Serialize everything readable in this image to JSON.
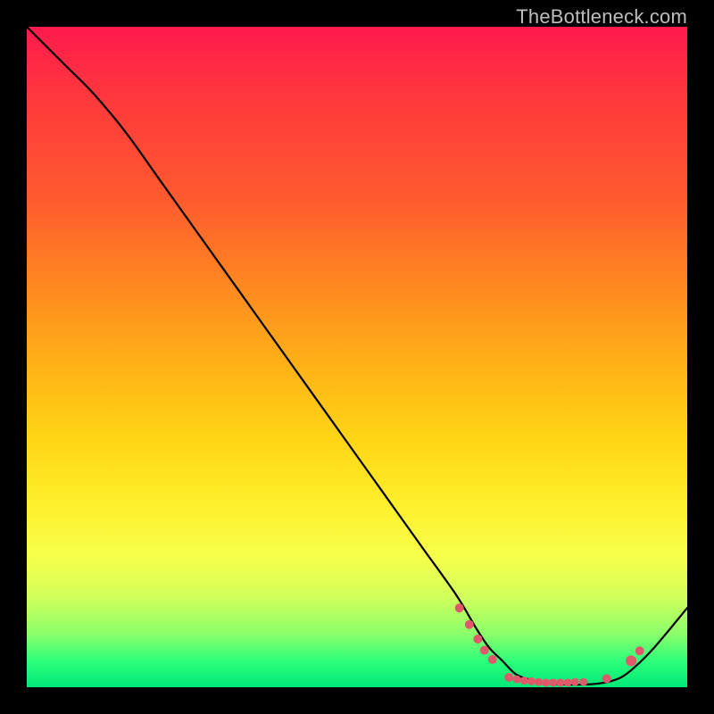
{
  "watermark": "TheBottleneck.com",
  "chart_data": {
    "type": "line",
    "title": "",
    "xlabel": "",
    "ylabel": "",
    "xlim": [
      0,
      100
    ],
    "ylim": [
      0,
      100
    ],
    "grid": false,
    "legend": false,
    "series": [
      {
        "name": "bottleneck-curve",
        "x": [
          0,
          3,
          6,
          10,
          15,
          20,
          25,
          30,
          35,
          40,
          45,
          50,
          55,
          60,
          65,
          68,
          70,
          72,
          74,
          76,
          78,
          80,
          82,
          84,
          86,
          88,
          90,
          92,
          95,
          100
        ],
        "y": [
          100,
          97,
          94,
          90,
          84,
          77,
          70,
          63,
          56,
          49,
          42,
          35,
          28,
          21,
          14,
          9,
          6,
          4,
          2,
          1.2,
          0.8,
          0.5,
          0.4,
          0.4,
          0.5,
          0.8,
          1.5,
          3,
          6,
          12
        ]
      }
    ],
    "dots": {
      "name": "markers",
      "points": [
        {
          "x": 65.5,
          "y": 12.0,
          "r": 5
        },
        {
          "x": 67.0,
          "y": 9.5,
          "r": 5
        },
        {
          "x": 68.3,
          "y": 7.3,
          "r": 5
        },
        {
          "x": 69.3,
          "y": 5.6,
          "r": 5
        },
        {
          "x": 70.5,
          "y": 4.2,
          "r": 5
        },
        {
          "x": 73.0,
          "y": 1.5,
          "r": 5
        },
        {
          "x": 74.2,
          "y": 1.2,
          "r": 4.5
        },
        {
          "x": 75.3,
          "y": 1.0,
          "r": 4.5
        },
        {
          "x": 76.4,
          "y": 0.9,
          "r": 4.5
        },
        {
          "x": 77.5,
          "y": 0.8,
          "r": 4.5
        },
        {
          "x": 78.6,
          "y": 0.7,
          "r": 4.5
        },
        {
          "x": 79.7,
          "y": 0.7,
          "r": 4.5
        },
        {
          "x": 80.8,
          "y": 0.7,
          "r": 4.5
        },
        {
          "x": 81.9,
          "y": 0.7,
          "r": 4.5
        },
        {
          "x": 83.0,
          "y": 0.8,
          "r": 4.5
        },
        {
          "x": 84.3,
          "y": 0.8,
          "r": 4.5
        },
        {
          "x": 87.8,
          "y": 1.3,
          "r": 5
        },
        {
          "x": 91.5,
          "y": 4.0,
          "r": 6
        },
        {
          "x": 92.8,
          "y": 5.5,
          "r": 5
        }
      ]
    }
  }
}
